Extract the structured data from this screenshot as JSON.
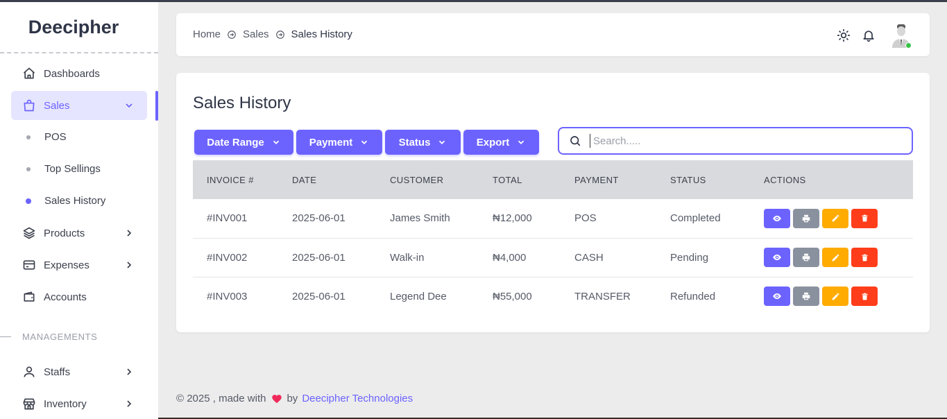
{
  "brand": "Deecipher",
  "sidebar": {
    "items": [
      {
        "label": "Dashboards"
      },
      {
        "label": "Sales"
      },
      {
        "label": "Products"
      },
      {
        "label": "Expenses"
      },
      {
        "label": "Accounts"
      },
      {
        "label": "Staffs"
      },
      {
        "label": "Inventory"
      }
    ],
    "sales_sub": [
      {
        "label": "POS"
      },
      {
        "label": "Top Sellings"
      },
      {
        "label": "Sales History"
      }
    ],
    "section_label": "MANAGEMENTS"
  },
  "breadcrumb": {
    "items": [
      "Home",
      "Sales",
      "Sales History"
    ]
  },
  "page": {
    "title": "Sales History"
  },
  "filters": {
    "date_range": "Date Range",
    "payment": "Payment",
    "status": "Status",
    "export": "Export"
  },
  "search": {
    "placeholder": "Search.....",
    "value": ""
  },
  "table": {
    "headers": [
      "INVOICE #",
      "DATE",
      "CUSTOMER",
      "TOTAL",
      "PAYMENT",
      "STATUS",
      "ACTIONS"
    ],
    "rows": [
      {
        "invoice": "#INV001",
        "date": "2025-06-01",
        "customer": "James Smith",
        "total": "₦12,000",
        "payment": "POS",
        "status": "Completed"
      },
      {
        "invoice": "#INV002",
        "date": "2025-06-01",
        "customer": "Walk-in",
        "total": "₦4,000",
        "payment": "CASH",
        "status": "Pending"
      },
      {
        "invoice": "#INV003",
        "date": "2025-06-01",
        "customer": "Legend Dee",
        "total": "₦55,000",
        "payment": "TRANSFER",
        "status": "Refunded"
      }
    ]
  },
  "footer": {
    "prefix": "© 2025 , made with",
    "by": "by",
    "company": "Deecipher Technologies"
  },
  "colors": {
    "accent": "#6c63ff",
    "view": "#6c63ff",
    "print": "#8a919e",
    "edit": "#ffab00",
    "delete": "#ff3d1a",
    "online": "#39c24a"
  },
  "icons": {
    "nav": [
      "home-icon",
      "shopping-bag-icon",
      "layers-icon",
      "credit-card-icon",
      "wallet-icon",
      "user-icon",
      "store-icon"
    ],
    "header": [
      "sun-icon",
      "bell-icon"
    ],
    "actions": [
      "eye-icon",
      "printer-icon",
      "pencil-icon",
      "trash-icon"
    ]
  }
}
